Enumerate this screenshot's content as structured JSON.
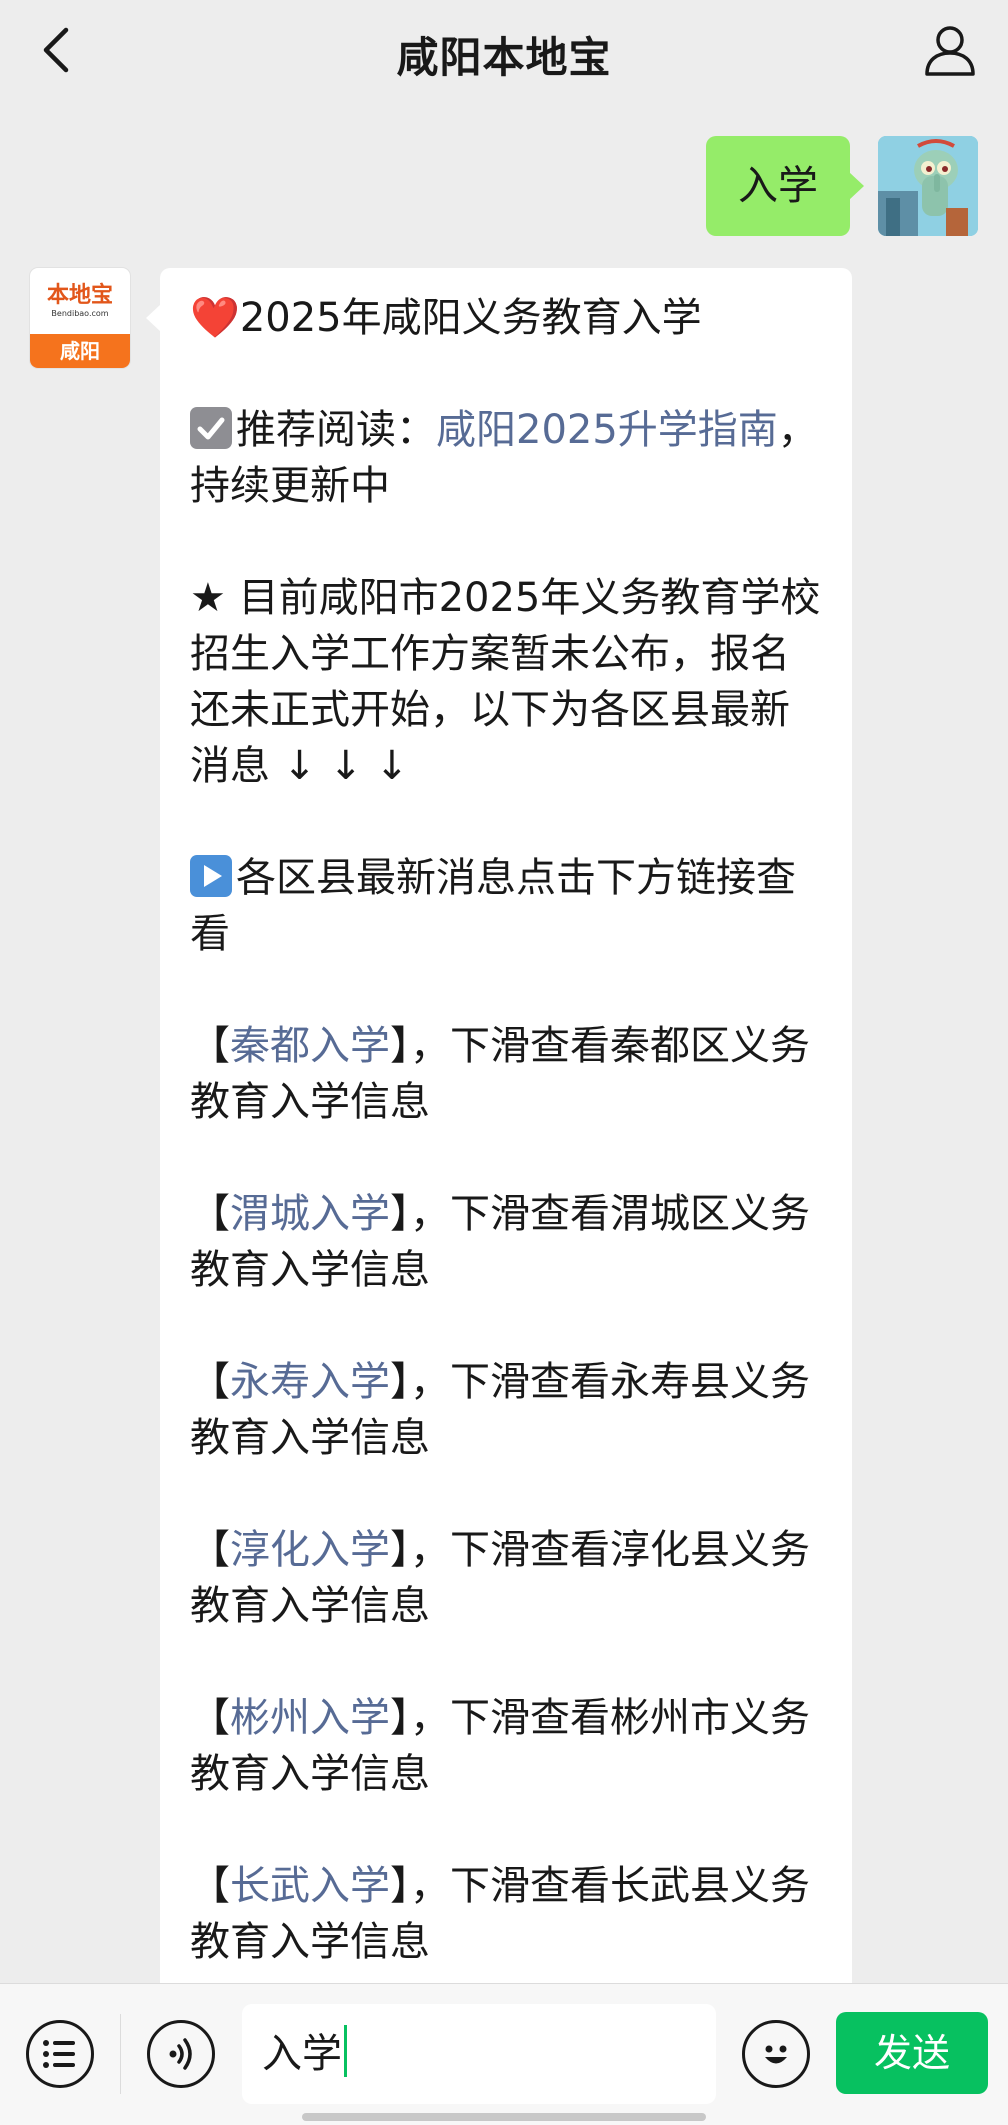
{
  "header": {
    "title": "咸阳本地宝",
    "back_icon": "chevron-left-icon",
    "profile_icon": "person-icon"
  },
  "chat": {
    "outgoing": {
      "text": "入学"
    },
    "bot_avatar": {
      "brand": "本地宝",
      "url": "Bendibao.com",
      "city": "咸阳"
    },
    "incoming": {
      "p1": {
        "emoji": "❤️",
        "text": "2025年咸阳义务教育入学"
      },
      "p2": {
        "link": "咸阳2025升学指南",
        "text": "，持续更新中"
      },
      "p3": "★ 目前咸阳市2025年义务教育学校招生入学工作方案暂未公布，报名还未正式开始，以下为各区县最新消息 ↓ ↓ ↓",
      "p4": "各区县最新消息点击下方链接查看",
      "districts": [
        {
          "open": "【",
          "link": "秦都入学",
          "text": "】，下滑查看秦都区义务教育入学信息"
        },
        {
          "open": "【",
          "link": "渭城入学",
          "text": "】，下滑查看渭城区义务教育入学信息"
        },
        {
          "open": "【",
          "link": "永寿入学",
          "text": "】，下滑查看永寿县义务教育入学信息"
        },
        {
          "open": "【",
          "link": "淳化入学",
          "text": "】，下滑查看淳化县义务教育入学信息"
        },
        {
          "open": "【",
          "link": "彬州入学",
          "text": "】，下滑查看彬州市义务教育入学信息"
        },
        {
          "open": "【",
          "link": "长武入学",
          "text": "】，下滑查看长武县义务教育入学信息"
        }
      ]
    }
  },
  "inputbar": {
    "menu_icon": "list-menu-icon",
    "voice_icon": "voice-icon",
    "input_value": "入学",
    "emoji_icon": "smiley-icon",
    "send_label": "发送"
  },
  "colors": {
    "accent": "#07c160",
    "bubble_out": "#95ec69",
    "link": "#576b95"
  }
}
